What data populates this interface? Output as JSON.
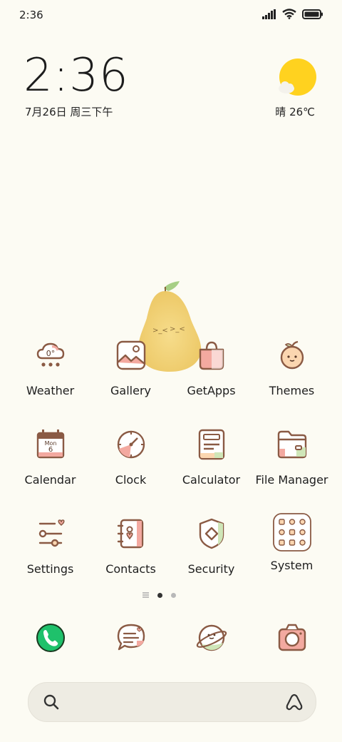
{
  "status": {
    "time": "2:36"
  },
  "clock": {
    "time": "2:36",
    "date": "7月26日 周三下午"
  },
  "weather_widget": {
    "condition": "晴",
    "temperature": "26℃"
  },
  "apps": [
    {
      "label": "Weather",
      "icon": "weather-icon"
    },
    {
      "label": "Gallery",
      "icon": "gallery-icon"
    },
    {
      "label": "GetApps",
      "icon": "getapps-icon"
    },
    {
      "label": "Themes",
      "icon": "themes-icon"
    },
    {
      "label": "Calendar",
      "icon": "calendar-icon",
      "icon_text": [
        "Mon",
        "6"
      ]
    },
    {
      "label": "Clock",
      "icon": "clock-icon"
    },
    {
      "label": "Calculator",
      "icon": "calculator-icon"
    },
    {
      "label": "File Manager",
      "icon": "file-manager-icon"
    },
    {
      "label": "Settings",
      "icon": "settings-icon"
    },
    {
      "label": "Contacts",
      "icon": "contacts-icon"
    },
    {
      "label": "Security",
      "icon": "security-icon"
    },
    {
      "label": "System",
      "icon": "system-folder-icon"
    }
  ],
  "weather_icon_text": "0°",
  "pages": {
    "count": 2,
    "current": 1
  },
  "dock": [
    {
      "icon": "phone-icon"
    },
    {
      "icon": "messages-icon"
    },
    {
      "icon": "browser-icon"
    },
    {
      "icon": "camera-icon"
    }
  ],
  "search": {
    "icon": "search-icon",
    "assistant_icon": "assistant-icon"
  },
  "colors": {
    "background": "#fcfbf3",
    "outline": "#8a5a44",
    "pink": "#f3a9a0",
    "green": "#cfe6b8",
    "phone_green": "#1fc16b",
    "sun": "#ffd21f"
  }
}
